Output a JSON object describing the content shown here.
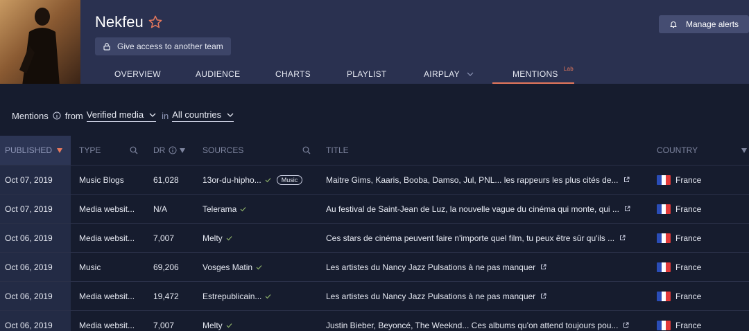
{
  "artist": {
    "name": "Nekfeu"
  },
  "header": {
    "access_button": "Give access to another team",
    "manage_alerts": "Manage alerts"
  },
  "tabs": [
    {
      "label": "OVERVIEW"
    },
    {
      "label": "AUDIENCE"
    },
    {
      "label": "CHARTS"
    },
    {
      "label": "PLAYLIST"
    },
    {
      "label": "AIRPLAY"
    },
    {
      "label": "MENTIONS",
      "tag": "Lab",
      "active": true
    }
  ],
  "filters": {
    "label": "Mentions",
    "from": "from",
    "source_value": "Verified media",
    "in": "in",
    "country_value": "All countries"
  },
  "table": {
    "headers": {
      "published": "PUBLISHED",
      "type": "TYPE",
      "dr": "DR",
      "sources": "SOURCES",
      "title": "TITLE",
      "country": "COUNTRY"
    },
    "rows": [
      {
        "date": "Oct 07, 2019",
        "type": "Music Blogs",
        "dr": "61,028",
        "source": "13or-du-hipho...",
        "pill": "Music",
        "title": "Maitre Gims, Kaaris, Booba, Damso, Jul, PNL... les rappeurs les plus cités de...",
        "country": "France"
      },
      {
        "date": "Oct 07, 2019",
        "type": "Media websit...",
        "dr": "N/A",
        "source": "Telerama",
        "title": "Au festival de Saint-Jean de Luz, la nouvelle vague du cinéma qui monte, qui ...",
        "country": "France"
      },
      {
        "date": "Oct 06, 2019",
        "type": "Media websit...",
        "dr": "7,007",
        "source": "Melty",
        "title": "Ces stars de cinéma peuvent faire n'importe quel film, tu peux être sûr qu'ils ...",
        "country": "France"
      },
      {
        "date": "Oct 06, 2019",
        "type": "Music",
        "dr": "69,206",
        "source": "Vosges Matin",
        "title": "Les artistes du Nancy Jazz Pulsations à ne pas manquer",
        "country": "France"
      },
      {
        "date": "Oct 06, 2019",
        "type": "Media websit...",
        "dr": "19,472",
        "source": "Estrepublicain...",
        "title": "Les artistes du Nancy Jazz Pulsations à ne pas manquer",
        "country": "France"
      },
      {
        "date": "Oct 06, 2019",
        "type": "Media websit...",
        "dr": "7,007",
        "source": "Melty",
        "title": "Justin Bieber, Beyoncé, The Weeknd... Ces albums qu'on attend toujours pou...",
        "country": "France"
      }
    ]
  },
  "colors": {
    "accent": "#e8795d",
    "header_bg": "#2a3150",
    "page_bg": "#161c2e",
    "verified": "#8fb36a"
  }
}
